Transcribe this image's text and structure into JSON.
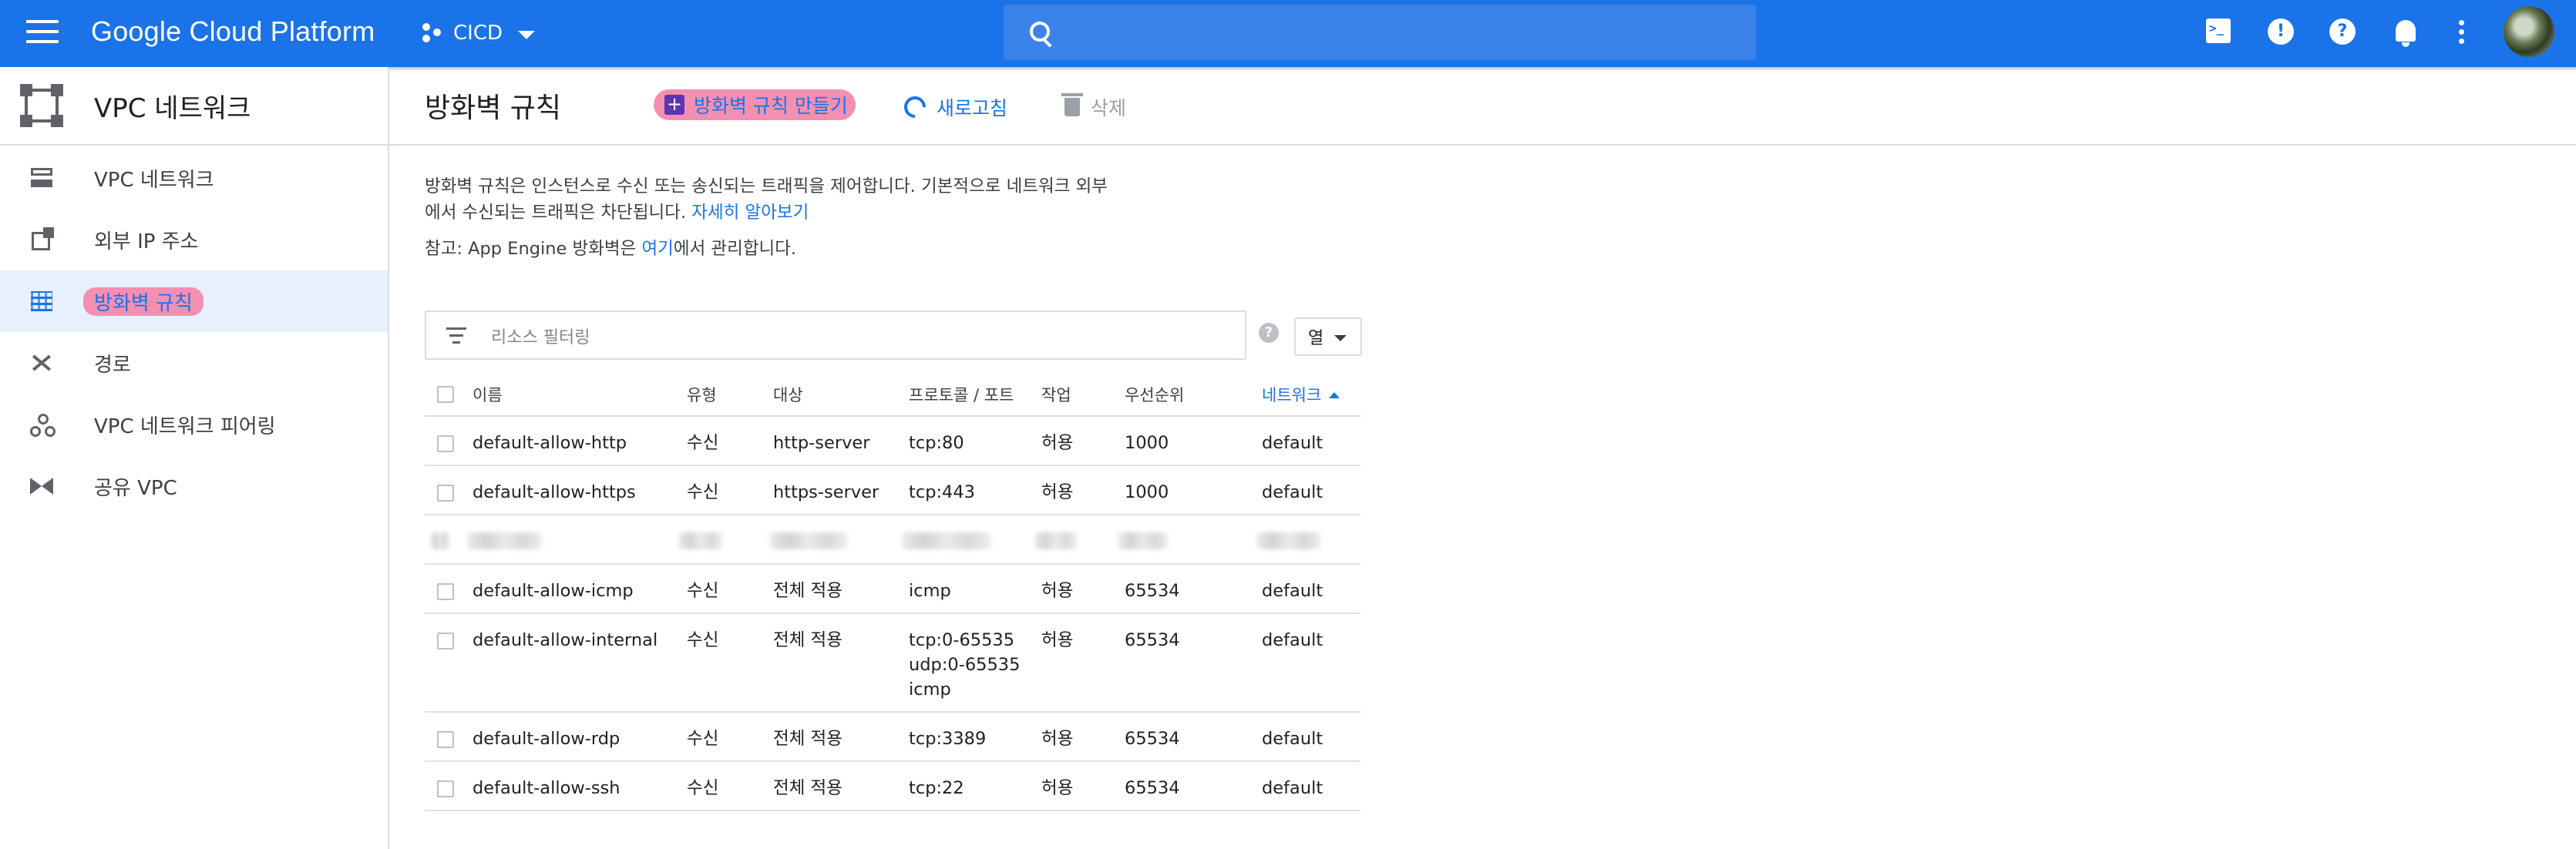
{
  "topbar": {
    "brand": "Google Cloud Platform",
    "project": "CICD",
    "search_placeholder": ""
  },
  "sidebar": {
    "title": "VPC 네트워크",
    "items": [
      {
        "label": "VPC 네트워크",
        "icon": "vpc-network-icon"
      },
      {
        "label": "외부 IP 주소",
        "icon": "external-ip-icon"
      },
      {
        "label": "방화벽 규칙",
        "icon": "firewall-icon",
        "active": true
      },
      {
        "label": "경로",
        "icon": "routes-icon"
      },
      {
        "label": "VPC 네트워크 피어링",
        "icon": "peering-icon"
      },
      {
        "label": "공유 VPC",
        "icon": "shared-vpc-icon"
      }
    ]
  },
  "main": {
    "title": "방화벽 규칙",
    "actions": {
      "create": "방화벽 규칙 만들기",
      "refresh": "새로고침",
      "delete": "삭제"
    },
    "description_line1": "방화벽 규칙은 인스턴스로 수신 또는 송신되는 트래픽을 제어합니다. 기본적으로 네트워크 외부",
    "description_line2": "에서 수신되는 트래픽은 차단됩니다.",
    "learn_more": "자세히 알아보기",
    "note_prefix": "참고: App Engine 방화벽은 ",
    "note_link": "여기",
    "note_suffix": "에서 관리합니다.",
    "filter_placeholder": "리소스 필터링",
    "columns_button": "열"
  },
  "table": {
    "headers": {
      "name": "이름",
      "type": "유형",
      "target": "대상",
      "protocol": "프로토콜 / 포트",
      "action": "작업",
      "priority": "우선순위",
      "network": "네트워크"
    },
    "rows": [
      {
        "name": "default-allow-http",
        "type": "수신",
        "target": "http-server",
        "protocol": [
          "tcp:80"
        ],
        "action": "허용",
        "priority": "1000",
        "network": "default"
      },
      {
        "name": "default-allow-https",
        "type": "수신",
        "target": "https-server",
        "protocol": [
          "tcp:443"
        ],
        "action": "허용",
        "priority": "1000",
        "network": "default"
      },
      {
        "name": "default-allow-icmp",
        "type": "수신",
        "target": "전체 적용",
        "protocol": [
          "icmp"
        ],
        "action": "허용",
        "priority": "65534",
        "network": "default"
      },
      {
        "name": "default-allow-internal",
        "type": "수신",
        "target": "전체 적용",
        "protocol": [
          "tcp:0-65535",
          "udp:0-65535",
          "icmp"
        ],
        "action": "허용",
        "priority": "65534",
        "network": "default"
      },
      {
        "name": "default-allow-rdp",
        "type": "수신",
        "target": "전체 적용",
        "protocol": [
          "tcp:3389"
        ],
        "action": "허용",
        "priority": "65534",
        "network": "default"
      },
      {
        "name": "default-allow-ssh",
        "type": "수신",
        "target": "전체 적용",
        "protocol": [
          "tcp:22"
        ],
        "action": "허용",
        "priority": "65534",
        "network": "default"
      }
    ]
  }
}
